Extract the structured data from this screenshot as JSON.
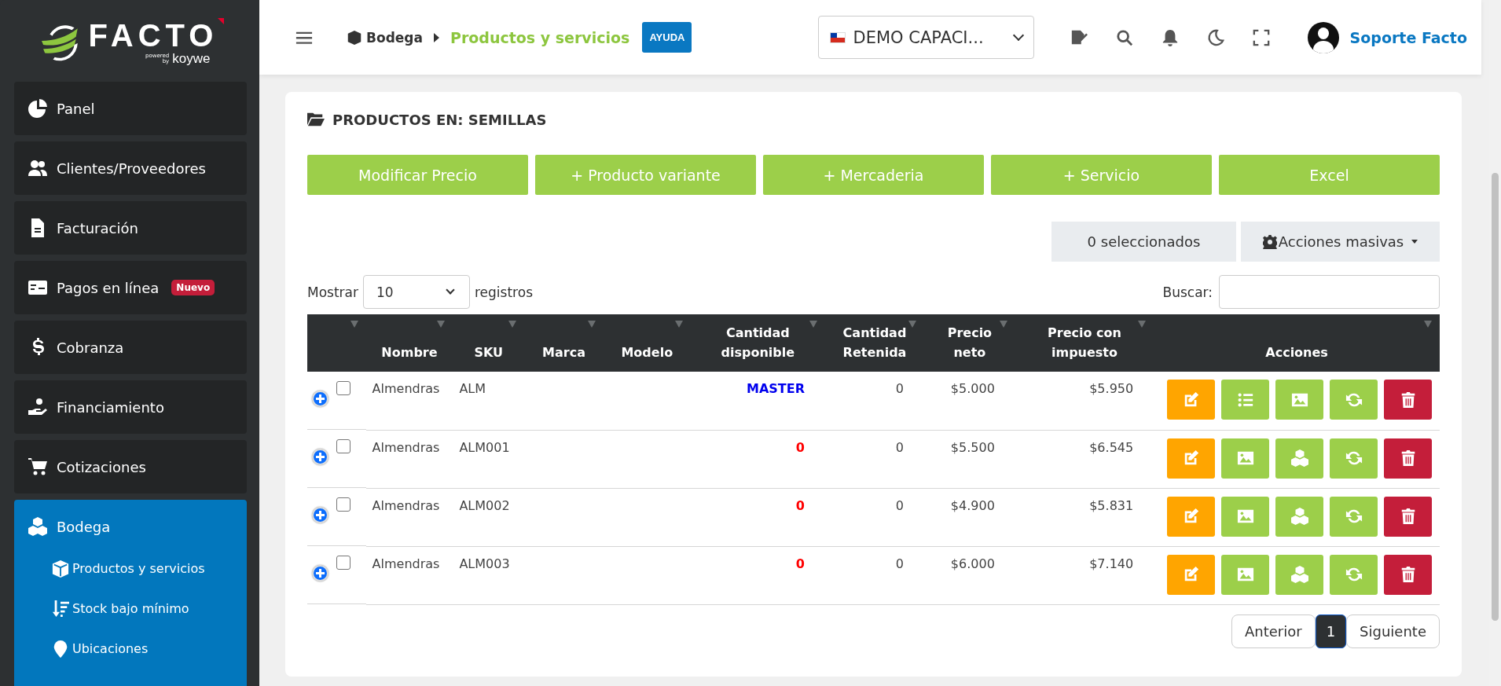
{
  "sidebar": {
    "logo": {
      "brand": "FACTO",
      "powered": "powered",
      "by": "by",
      "partner": "koywe"
    },
    "items": [
      {
        "label": "Panel",
        "kind": "pie",
        "selected": false
      },
      {
        "label": "Clientes/Proveedores",
        "kind": "users",
        "selected": false
      },
      {
        "label": "Facturación",
        "kind": "doc",
        "selected": false
      },
      {
        "label": "Pagos en línea",
        "kind": "card",
        "selected": false,
        "badge": "Nuevo"
      },
      {
        "label": "Cobranza",
        "kind": "dollar",
        "selected": false
      },
      {
        "label": "Financiamiento",
        "kind": "hand",
        "selected": false
      },
      {
        "label": "Cotizaciones",
        "kind": "cart",
        "selected": false
      },
      {
        "label": "Bodega",
        "kind": "cubes",
        "selected": true,
        "expanded": true,
        "children": [
          {
            "label": "Productos y servicios",
            "kind": "box"
          },
          {
            "label": "Stock bajo mínimo",
            "kind": "sortdown"
          },
          {
            "label": "Ubicaciones",
            "kind": "pin"
          }
        ]
      }
    ]
  },
  "header": {
    "breadcrumb": [
      {
        "label": "Bodega",
        "active": false
      },
      {
        "label": "Productos y servicios",
        "active": true
      }
    ],
    "help_button": "AYUDA",
    "company_select": {
      "value": "DEMO CAPACI..."
    },
    "user": {
      "name": "Soporte Facto"
    }
  },
  "card": {
    "title": "PRODUCTOS EN: SEMILLAS",
    "toolbar": [
      "Modificar Precio",
      "+ Producto variante",
      "+ Mercaderia",
      "+ Servicio",
      "Excel"
    ],
    "selection": "0 seleccionados",
    "bulk_actions": "Acciones masivas",
    "length": {
      "before": "Mostrar",
      "value": "10",
      "after": "registros"
    },
    "search": {
      "label": "Buscar:"
    },
    "table": {
      "columns": [
        "",
        "Nombre",
        "SKU",
        "Marca",
        "Modelo",
        "Cantidad disponible",
        "Cantidad Retenida",
        "Precio neto",
        "Precio con impuesto",
        "Acciones"
      ],
      "rows": [
        {
          "checked": false,
          "name": "Almendras",
          "sku": "ALM",
          "available": {
            "text": "MASTER",
            "kind": "master"
          },
          "retained": "0",
          "net": "$5.000",
          "gross": "$5.950",
          "actions": [
            {
              "kind": "edit"
            },
            {
              "kind": "list"
            },
            {
              "kind": "image"
            },
            {
              "kind": "refresh"
            },
            {
              "kind": "delete"
            }
          ]
        },
        {
          "checked": false,
          "name": "Almendras",
          "sku": "ALM001",
          "available": {
            "text": "0",
            "kind": "stock"
          },
          "retained": "0",
          "net": "$5.500",
          "gross": "$6.545",
          "actions": [
            {
              "kind": "edit"
            },
            {
              "kind": "image"
            },
            {
              "kind": "cubes"
            },
            {
              "kind": "refresh"
            },
            {
              "kind": "delete"
            }
          ]
        },
        {
          "checked": false,
          "name": "Almendras",
          "sku": "ALM002",
          "available": {
            "text": "0",
            "kind": "stock"
          },
          "retained": "0",
          "net": "$4.900",
          "gross": "$5.831",
          "actions": [
            {
              "kind": "edit"
            },
            {
              "kind": "image"
            },
            {
              "kind": "cubes"
            },
            {
              "kind": "refresh"
            },
            {
              "kind": "delete"
            }
          ]
        },
        {
          "checked": false,
          "name": "Almendras",
          "sku": "ALM003",
          "available": {
            "text": "0",
            "kind": "stock"
          },
          "retained": "0",
          "net": "$6.000",
          "gross": "$7.140",
          "actions": [
            {
              "kind": "edit"
            },
            {
              "kind": "image"
            },
            {
              "kind": "cubes"
            },
            {
              "kind": "refresh"
            },
            {
              "kind": "delete"
            }
          ]
        }
      ]
    },
    "pagination": {
      "previous": "Anterior",
      "pages": [
        {
          "label": "1",
          "selected": true
        }
      ],
      "next": "Siguiente"
    }
  }
}
